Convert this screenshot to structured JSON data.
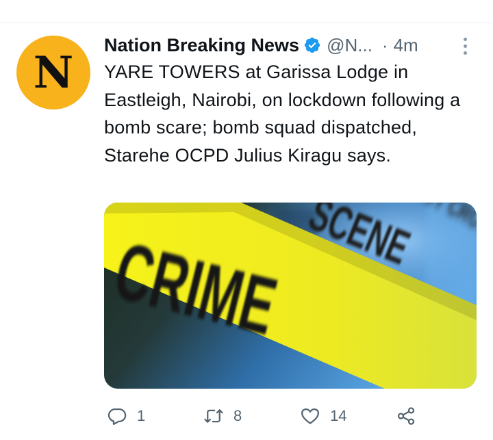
{
  "tweet": {
    "author_name": "Nation Breaking News",
    "avatar_letter": "N",
    "handle": "@N...",
    "separator": "·",
    "time": "4m",
    "text": "YARE TOWERS at Garissa Lodge in Eastleigh, Nairobi, on lockdown following a bomb scare; bomb squad dispatched, Starehe OCPD Julius Kiragu says.",
    "media": {
      "tape_text_large": "CRIME",
      "tape_text_medium": "SCENE",
      "tape_text_small": "DO NOT CROSS"
    }
  },
  "actions": {
    "reply_count": "1",
    "retweet_count": "8",
    "like_count": "14"
  },
  "colors": {
    "avatar_bg": "#f8b21c",
    "verified_blue": "#1d9bf0",
    "secondary_text": "#536471",
    "tape_yellow": "#f2ee1c"
  },
  "icons": [
    "verified-badge-icon",
    "more-options-icon",
    "reply-icon",
    "retweet-icon",
    "like-icon",
    "share-icon"
  ]
}
